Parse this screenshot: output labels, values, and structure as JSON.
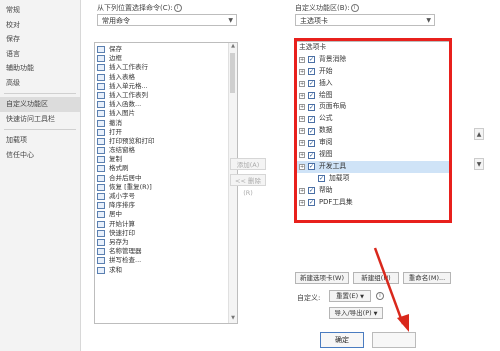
{
  "nav": {
    "items": [
      "常规",
      "校对",
      "保存",
      "语言",
      "辅助功能",
      "高级"
    ],
    "selected": "自定义功能区",
    "items2": [
      "自定义功能区",
      "快速访问工具栏"
    ],
    "items3": [
      "加载项",
      "信任中心"
    ]
  },
  "left": {
    "label": "从下列位置选择命令(C):",
    "combo_value": "常用命令",
    "commands": [
      {
        "label": "保存",
        "sub": ""
      },
      {
        "label": "边框",
        "sub": "▸"
      },
      {
        "label": "插入工作表行",
        "sub": ""
      },
      {
        "label": "插入表格",
        "sub": ""
      },
      {
        "label": "插入单元格...",
        "sub": ""
      },
      {
        "label": "插入工作表列",
        "sub": ""
      },
      {
        "label": "插入函数...",
        "sub": ""
      },
      {
        "label": "插入图片",
        "sub": ""
      },
      {
        "label": "撤消",
        "sub": "▸"
      },
      {
        "label": "打开",
        "sub": ""
      },
      {
        "label": "打印预览和打印",
        "sub": ""
      },
      {
        "label": "冻结窗格",
        "sub": "▸"
      },
      {
        "label": "复制",
        "sub": ""
      },
      {
        "label": "格式刷",
        "sub": ""
      },
      {
        "label": "合并后居中",
        "sub": ""
      },
      {
        "label": "恢复 [重复(R)]",
        "sub": ""
      },
      {
        "label": "减小字号",
        "sub": ""
      },
      {
        "label": "降序排序",
        "sub": ""
      },
      {
        "label": "居中",
        "sub": ""
      },
      {
        "label": "开始计算",
        "sub": ""
      },
      {
        "label": "快速打印",
        "sub": ""
      },
      {
        "label": "另存为",
        "sub": ""
      },
      {
        "label": "名称管理器",
        "sub": ""
      },
      {
        "label": "拼写检查...",
        "sub": ""
      },
      {
        "label": "求和",
        "sub": ""
      }
    ]
  },
  "middle": {
    "add": "添加(A) >>",
    "remove": "<< 删除(R)"
  },
  "right": {
    "label": "自定义功能区(B):",
    "combo_value": "主选项卡",
    "tree_header": "主选项卡",
    "tree": [
      {
        "label": "背景消除",
        "expander": "+",
        "check": "✓",
        "indent": 0
      },
      {
        "label": "开始",
        "expander": "+",
        "check": "✓",
        "indent": 0
      },
      {
        "label": "插入",
        "expander": "+",
        "check": "✓",
        "indent": 0
      },
      {
        "label": "绘图",
        "expander": "+",
        "check": "✓",
        "indent": 0
      },
      {
        "label": "页面布局",
        "expander": "+",
        "check": "✓",
        "indent": 0
      },
      {
        "label": "公式",
        "expander": "+",
        "check": "✓",
        "indent": 0
      },
      {
        "label": "数据",
        "expander": "+",
        "check": "✓",
        "indent": 0
      },
      {
        "label": "审阅",
        "expander": "+",
        "check": "✓",
        "indent": 0
      },
      {
        "label": "视图",
        "expander": "+",
        "check": "✓",
        "indent": 0
      },
      {
        "label": "开发工具",
        "expander": "+",
        "check": "✓",
        "indent": 0,
        "selected": true
      },
      {
        "label": "加载项",
        "expander": "",
        "check": "✓",
        "indent": 1
      },
      {
        "label": "帮助",
        "expander": "+",
        "check": "✓",
        "indent": 0
      },
      {
        "label": "PDF工具集",
        "expander": "+",
        "check": "✓",
        "indent": 0
      }
    ],
    "new_tab": "新建选项卡(W)",
    "new_group": "新建组(N)",
    "rename": "重命名(M)...",
    "customize_label": "自定义:",
    "reset": "重置(E)",
    "import_export": "导入/导出(P)",
    "ok": "确定"
  },
  "colors": {
    "highlight": "#e8201c",
    "selection": "#cfe3f7"
  }
}
